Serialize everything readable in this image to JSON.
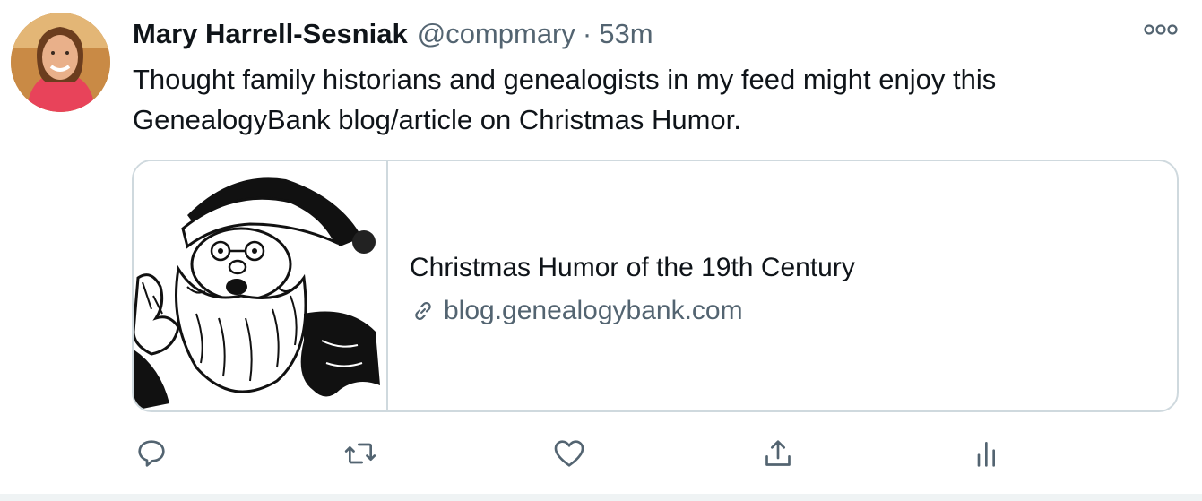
{
  "tweet": {
    "author_name": "Mary Harrell-Sesniak",
    "handle": "@compmary",
    "separator": "·",
    "time": "53m",
    "text": "Thought family historians and genealogists in my feed might enjoy this GenealogyBank blog/article on Christmas Humor.",
    "more_icon": "more-horizontal-icon"
  },
  "card": {
    "title": "Christmas Humor of the 19th Century",
    "domain": "blog.genealogybank.com",
    "image_subject": "vintage Santa Claus illustration",
    "link_icon": "link-icon"
  },
  "actions": [
    {
      "name": "reply",
      "icon": "reply-icon"
    },
    {
      "name": "retweet",
      "icon": "retweet-icon"
    },
    {
      "name": "like",
      "icon": "heart-icon"
    },
    {
      "name": "share",
      "icon": "share-icon"
    },
    {
      "name": "analytics",
      "icon": "analytics-icon"
    }
  ],
  "colors": {
    "text_primary": "#0f1419",
    "text_secondary": "#536471",
    "border": "#cfd9de"
  }
}
